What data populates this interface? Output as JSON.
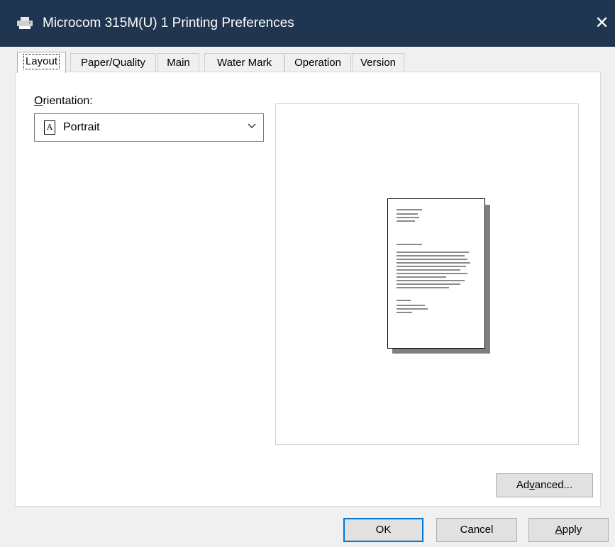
{
  "window": {
    "title": "Microcom 315M(U) 1 Printing Preferences",
    "close_glyph": "✕",
    "title_icon": "printer-icon"
  },
  "tabs": [
    {
      "label": "Layout",
      "active": true
    },
    {
      "label": "Paper/Quality",
      "active": false
    },
    {
      "label": "Main",
      "active": false
    },
    {
      "label": "Water Mark",
      "active": false
    },
    {
      "label": "Operation",
      "active": false
    },
    {
      "label": "Version",
      "active": false
    }
  ],
  "layout": {
    "orientation_label_mnemonic": "O",
    "orientation_label_rest": "rientation:",
    "orientation_value": "Portrait",
    "orientation_icon_glyph": "A",
    "advanced_pre": "Ad",
    "advanced_mnemonic": "v",
    "advanced_post": "anced..."
  },
  "footer": {
    "ok_label": "OK",
    "cancel_label": "Cancel",
    "apply_mnemonic": "A",
    "apply_rest": "pply"
  },
  "colors": {
    "titlebar": "#1f3550",
    "default_button_border": "#0078d7"
  }
}
